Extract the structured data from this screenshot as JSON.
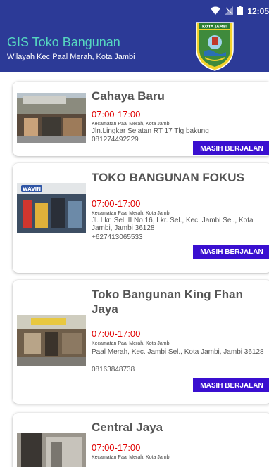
{
  "status_bar": {
    "time": "12:05",
    "icons": [
      "wifi-icon",
      "signal-icon",
      "battery-icon"
    ]
  },
  "app_bar": {
    "title": "GIS Toko Bangunan",
    "subtitle": "Wilayah Kec Paal Merah, Kota Jambi",
    "logo_text": "KOTA JAMBI",
    "background": "#2c3a97",
    "title_color": "#56d6c0"
  },
  "stores": [
    {
      "name": "Cahaya Baru",
      "hours": "07:00-17:00",
      "district": "Kecamatan Paal Merah, Kota Jambi",
      "address": "Jln.Lingkar Selatan RT 17 Tlg bakung",
      "phone": "081274492229",
      "status": "MASIH BERJALAN"
    },
    {
      "name": "TOKO BANGUNAN FOKUS",
      "hours": "07:00-17:00",
      "district": "Kecamatan Paal Merah, Kota Jambi",
      "address": "Jl. Lkr. Sel. II No.16, Lkr. Sel., Kec. Jambi Sel., Kota Jambi, Jambi 36128",
      "phone": "+627413065533",
      "status": "MASIH BERJALAN",
      "sign_text": "WAVIN"
    },
    {
      "name": "Toko Bangunan King Fhan Jaya",
      "hours": "07:00-17:00",
      "district": "Kecamatan Paal Merah, Kota Jambi",
      "address": "Paal Merah, Kec. Jambi Sel., Kota Jambi, Jambi 36128",
      "phone": "08163848738",
      "status": "MASIH BERJALAN"
    },
    {
      "name": "Central Jaya",
      "hours": "07:00-17:00",
      "district": "Kecamatan Paal Merah, Kota Jambi"
    }
  ],
  "colors": {
    "hours": "#e00000",
    "status_button": "#3a0fd0"
  }
}
